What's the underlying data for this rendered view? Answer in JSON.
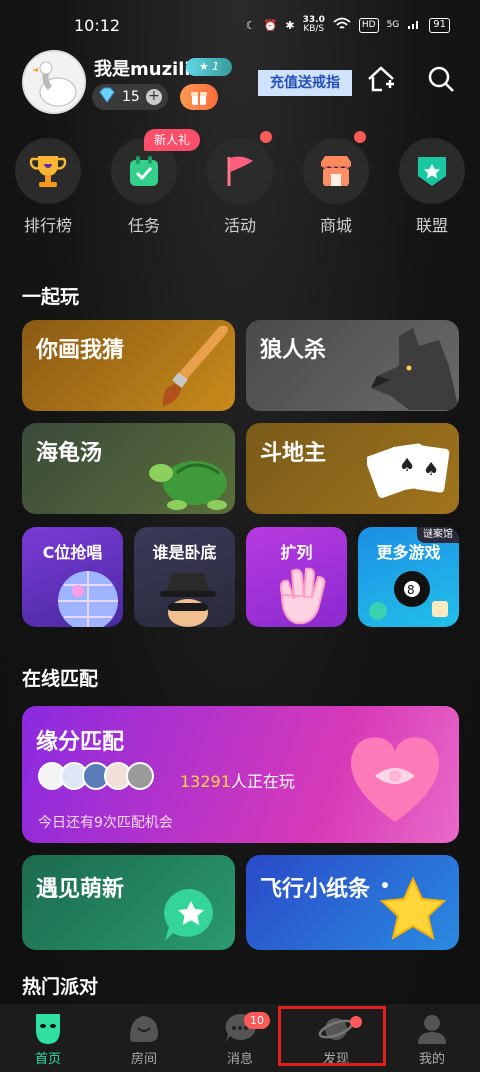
{
  "status_bar": {
    "time": "10:12",
    "net_speed": "33.0",
    "net_unit": "KB/S",
    "hd": "HD",
    "signal": "5G",
    "battery": "91"
  },
  "header": {
    "username": "我是muzili",
    "level": "1",
    "diamonds": "15",
    "promo": "充值送戒指"
  },
  "quick_actions": [
    {
      "label": "排行榜",
      "icon": "trophy-icon"
    },
    {
      "label": "任务",
      "icon": "task-icon",
      "tag": "新人礼"
    },
    {
      "label": "活动",
      "icon": "flag-icon"
    },
    {
      "label": "商城",
      "icon": "shop-icon"
    },
    {
      "label": "联盟",
      "icon": "league-icon"
    }
  ],
  "play_together": {
    "heading": "一起玩",
    "cards": [
      "你画我猜",
      "狼人杀",
      "海龟汤",
      "斗地主"
    ],
    "small_cards": [
      "C位抢唱",
      "谁是卧底",
      "扩列",
      "更多游戏"
    ],
    "more_badge": "谜案馆"
  },
  "online_match": {
    "heading": "在线匹配",
    "main_title": "缘分匹配",
    "count": "13291",
    "count_suffix": "人正在玩",
    "remaining": "今日还有9次匹配机会",
    "card2": "遇见萌新",
    "card3": "飞行小纸条"
  },
  "hot_party": {
    "heading": "热门派对"
  },
  "tabs": [
    {
      "label": "首页",
      "active": true
    },
    {
      "label": "房间"
    },
    {
      "label": "消息",
      "badge": "10"
    },
    {
      "label": "发现"
    },
    {
      "label": "我的"
    }
  ],
  "colors": {
    "accent": "#2de0a0",
    "badge": "#ff5a5a",
    "highlight_box": "#e0201a",
    "count": "#ffd23f"
  }
}
